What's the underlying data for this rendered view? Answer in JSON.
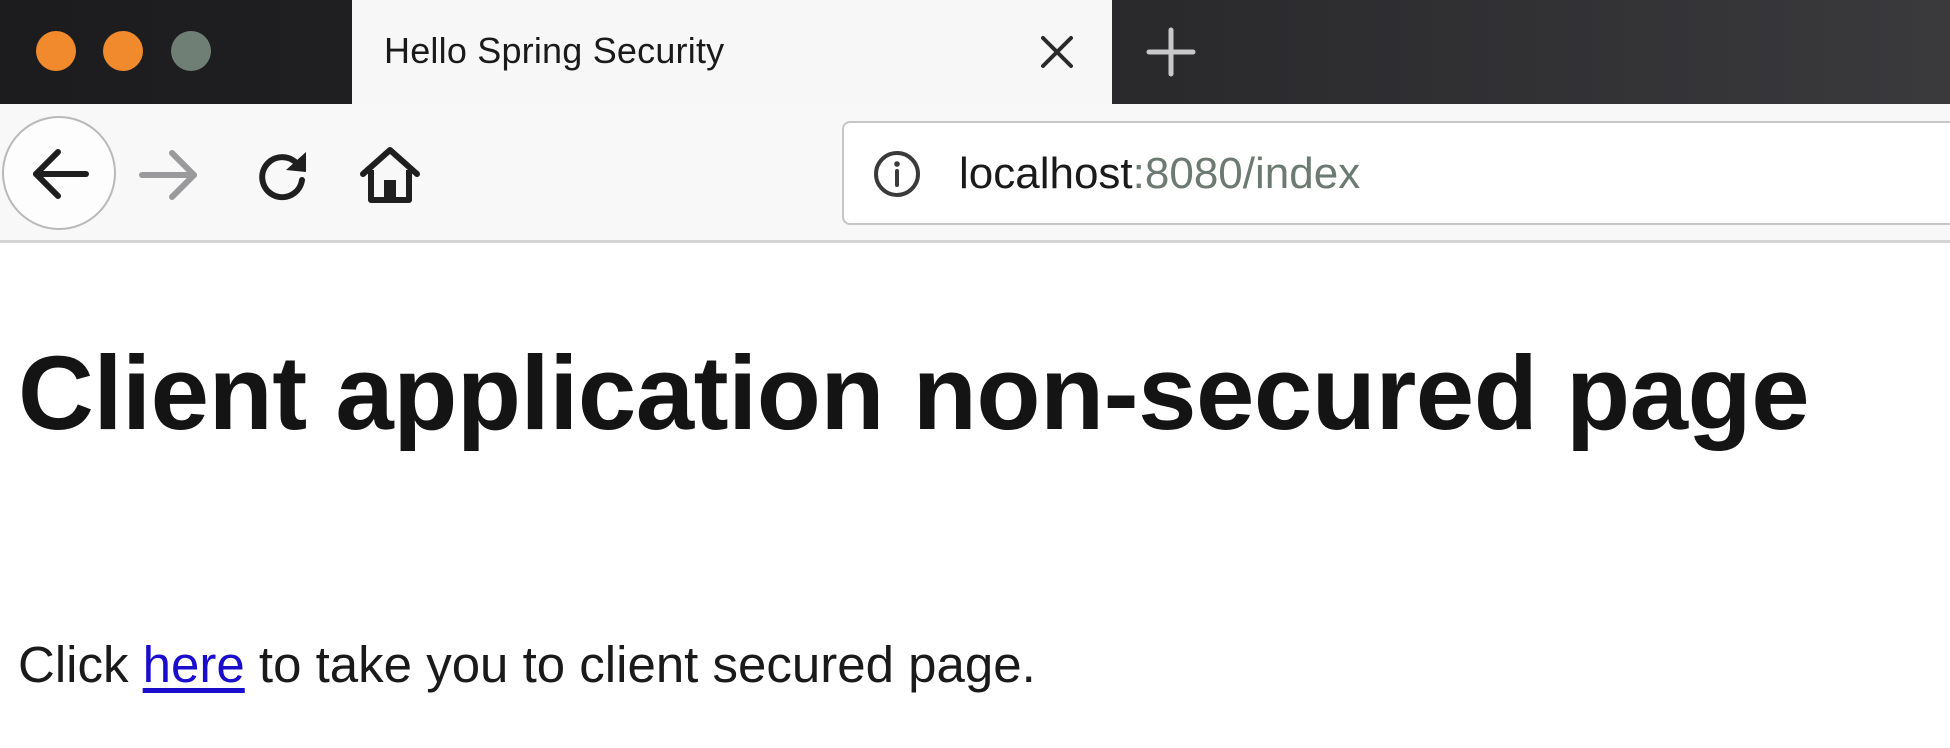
{
  "window": {
    "traffic_lights": {
      "close_color": "#f08a2c",
      "minimize_color": "#f08a2c",
      "maximize_color": "#6f7f75"
    }
  },
  "tab": {
    "title": "Hello Spring Security",
    "close_icon": "close-icon"
  },
  "toolbar": {
    "new_tab_icon": "plus-icon",
    "back_icon": "arrow-left-icon",
    "forward_icon": "arrow-right-icon",
    "reload_icon": "reload-icon",
    "home_icon": "home-icon"
  },
  "address_bar": {
    "info_icon": "info-icon",
    "host": "localhost",
    "rest": ":8080/index"
  },
  "page": {
    "heading": "Client application non-secured page",
    "text_before": "Click ",
    "link_text": "here",
    "text_after": " to take you to client secured page.",
    "link_color": "#1a0dcc"
  }
}
